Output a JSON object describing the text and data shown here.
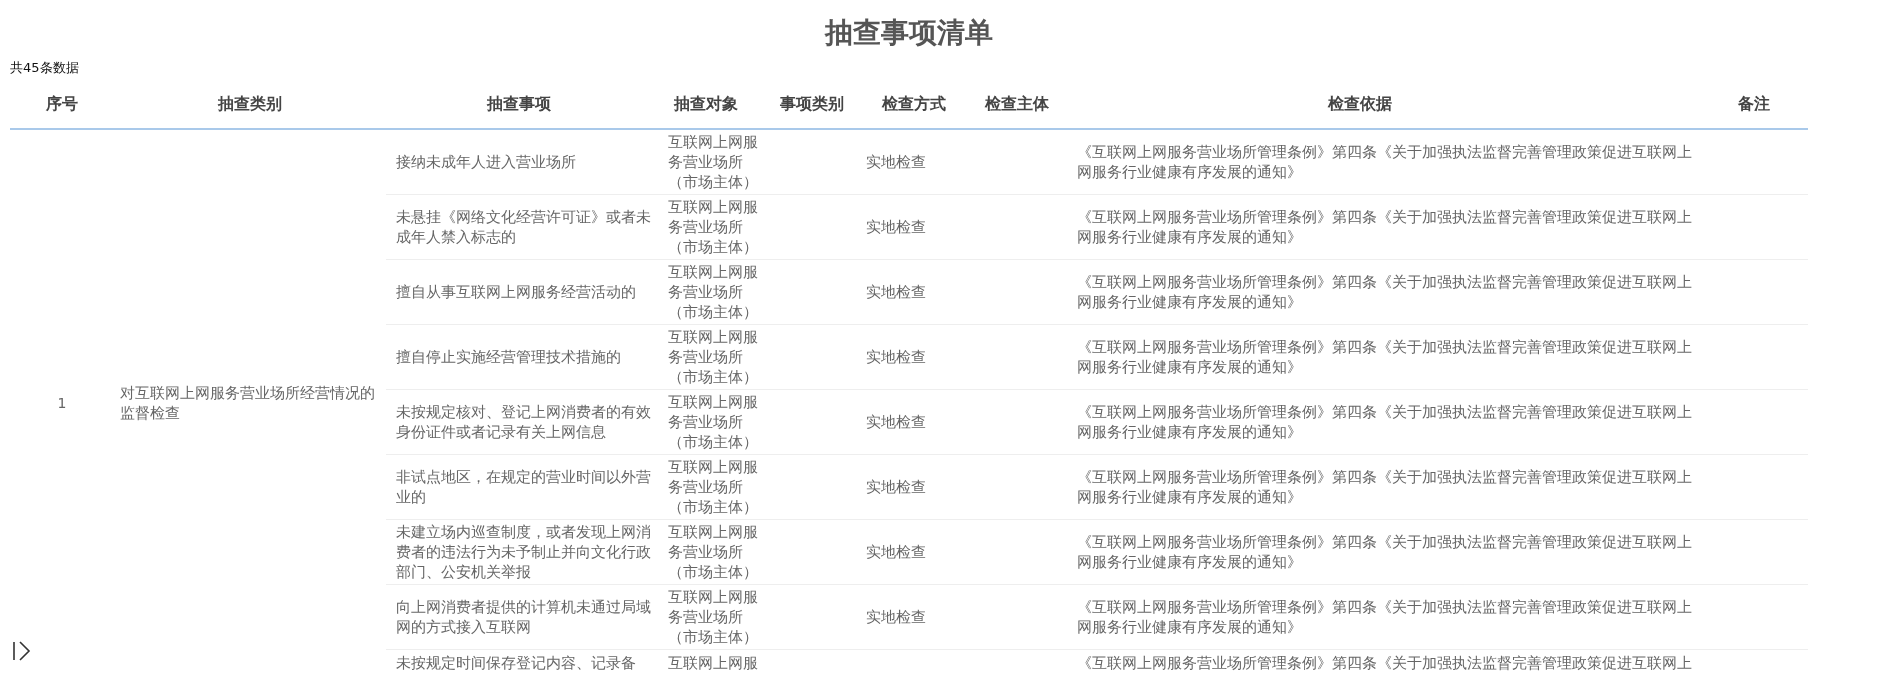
{
  "title": "抽查事项清单",
  "record_count": "共45条数据",
  "table": {
    "columns": [
      "序号",
      "抽查类别",
      "抽查事项",
      "抽查对象",
      "事项类别",
      "检查方式",
      "检查主体",
      "检查依据",
      "备注"
    ],
    "groups": [
      {
        "index": "1",
        "category": "对互联网上网服务营业场所经营情况的监督检查",
        "rows": [
          {
            "item": "接纳未成年人进入营业场所",
            "object": "互联网上网服务营业场所（市场主体）",
            "method": "实地检查",
            "basis": "《互联网上网服务营业场所管理条例》第四条《关于加强执法监督完善管理政策促进互联网上网服务行业健康有序发展的通知》"
          },
          {
            "item": "未悬挂《网络文化经营许可证》或者未成年人禁入标志的",
            "object": "互联网上网服务营业场所（市场主体）",
            "method": "实地检查",
            "basis": "《互联网上网服务营业场所管理条例》第四条《关于加强执法监督完善管理政策促进互联网上网服务行业健康有序发展的通知》"
          },
          {
            "item": "擅自从事互联网上网服务经营活动的",
            "object": "互联网上网服务营业场所（市场主体）",
            "method": "实地检查",
            "basis": "《互联网上网服务营业场所管理条例》第四条《关于加强执法监督完善管理政策促进互联网上网服务行业健康有序发展的通知》"
          },
          {
            "item": "擅自停止实施经营管理技术措施的",
            "object": "互联网上网服务营业场所（市场主体）",
            "method": "实地检查",
            "basis": "《互联网上网服务营业场所管理条例》第四条《关于加强执法监督完善管理政策促进互联网上网服务行业健康有序发展的通知》"
          },
          {
            "item": "未按规定核对、登记上网消费者的有效身份证件或者记录有关上网信息",
            "object": "互联网上网服务营业场所（市场主体）",
            "method": "实地检查",
            "basis": "《互联网上网服务营业场所管理条例》第四条《关于加强执法监督完善管理政策促进互联网上网服务行业健康有序发展的通知》"
          },
          {
            "item": "非试点地区，在规定的营业时间以外营业的",
            "object": "互联网上网服务营业场所（市场主体）",
            "method": "实地检查",
            "basis": "《互联网上网服务营业场所管理条例》第四条《关于加强执法监督完善管理政策促进互联网上网服务行业健康有序发展的通知》"
          },
          {
            "item": "未建立场内巡查制度，或者发现上网消费者的违法行为未予制止并向文化行政部门、公安机关举报",
            "object": "互联网上网服务营业场所（市场主体）",
            "method": "实地检查",
            "basis": "《互联网上网服务营业场所管理条例》第四条《关于加强执法监督完善管理政策促进互联网上网服务行业健康有序发展的通知》"
          },
          {
            "item": "向上网消费者提供的计算机未通过局域网的方式接入互联网",
            "object": "互联网上网服务营业场所（市场主体）",
            "method": "实地检查",
            "basis": "《互联网上网服务营业场所管理条例》第四条《关于加强执法监督完善管理政策促进互联网上网服务行业健康有序发展的通知》"
          },
          {
            "item": "未按规定时间保存登记内容、记录备",
            "object": "互联网上网服",
            "basis": "《互联网上网服务营业场所管理条例》第四条《关于加强执法监督完善管理政策促进互联网上"
          }
        ]
      }
    ]
  }
}
